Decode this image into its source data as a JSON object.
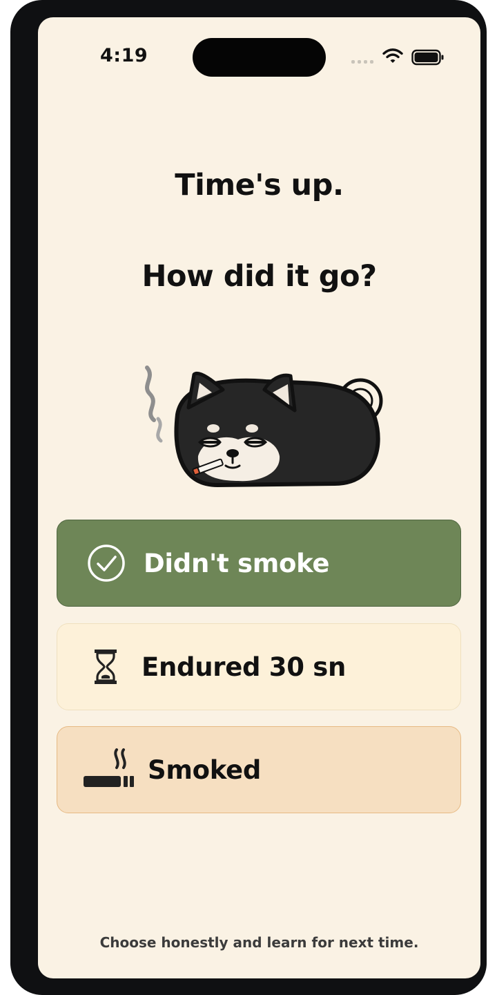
{
  "status_bar": {
    "time": "4:19"
  },
  "header": {
    "title_line1": "Time's up.",
    "title_line2": "How did it go?"
  },
  "options": [
    {
      "label": "Didn't smoke",
      "icon": "check-circle-icon",
      "color": "#6e8657"
    },
    {
      "label": "Endured 30 sn",
      "icon": "hourglass-icon",
      "color": "#fdf1d9"
    },
    {
      "label": "Smoked",
      "icon": "cigarette-icon",
      "color": "#f6dfc1"
    }
  ],
  "mascot": {
    "icon": "smoking-dog-mascot-icon"
  },
  "footer": {
    "hint": "Choose honestly and learn for next time."
  },
  "colors": {
    "background": "#faf2e4",
    "success": "#6e8657",
    "neutral": "#fdf1d9",
    "warning": "#f6dfc1"
  }
}
